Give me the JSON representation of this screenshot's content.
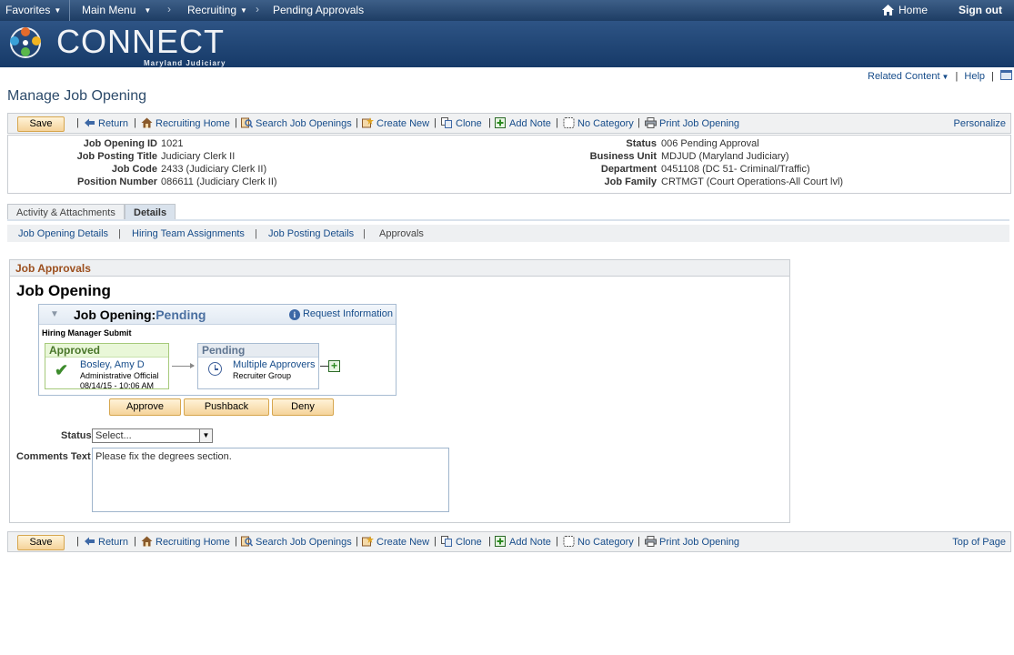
{
  "nav": {
    "favorites": "Favorites",
    "main_menu": "Main Menu",
    "recruiting": "Recruiting",
    "current": "Pending Approvals",
    "home": "Home",
    "sign_out": "Sign out"
  },
  "banner": {
    "logo": "CONNECT",
    "subtitle": "Maryland Judiciary"
  },
  "related": {
    "related_content": "Related Content",
    "help": "Help"
  },
  "page_title": "Manage Job Opening",
  "toolbar": {
    "save": "Save",
    "return": "Return",
    "recruiting_home": "Recruiting Home",
    "search": "Search Job Openings",
    "create_new": "Create New",
    "clone": "Clone",
    "add_note": "Add Note",
    "no_category": "No Category",
    "print": "Print Job Opening",
    "personalize": "Personalize",
    "top_of_page": "Top of Page"
  },
  "header": {
    "job_opening_id": {
      "label": "Job Opening ID",
      "value": "1021"
    },
    "job_posting_title": {
      "label": "Job Posting Title",
      "value": "Judiciary Clerk II"
    },
    "job_code": {
      "label": "Job Code",
      "value": "2433 (Judiciary Clerk II)"
    },
    "position_number": {
      "label": "Position Number",
      "value": "086611 (Judiciary Clerk II)"
    },
    "status": {
      "label": "Status",
      "value": "006 Pending Approval"
    },
    "business_unit": {
      "label": "Business Unit",
      "value": "MDJUD (Maryland Judiciary)"
    },
    "department": {
      "label": "Department",
      "value": "0451108 (DC 51- Criminal/Traffic)"
    },
    "job_family": {
      "label": "Job Family",
      "value": "CRTMGT (Court Operations-All Court lvl)"
    }
  },
  "tabs": {
    "activity": "Activity & Attachments",
    "details": "Details"
  },
  "subnav": {
    "job_opening_details": "Job Opening Details",
    "hiring_team": "Hiring Team Assignments",
    "job_posting": "Job Posting Details",
    "approvals": "Approvals"
  },
  "approvals": {
    "header": "Job Approvals",
    "title": "Job Opening",
    "flow_title": "Job Opening:",
    "flow_status": "Pending",
    "request_info": "Request Information",
    "stage": "Hiring Manager Submit",
    "approved": {
      "heading": "Approved",
      "name": "Bosley, Amy D",
      "role": "Administrative Official",
      "date": "08/14/15 - 10:06 AM"
    },
    "pending": {
      "heading": "Pending",
      "name": "Multiple Approvers",
      "group": "Recruiter Group"
    },
    "buttons": {
      "approve": "Approve",
      "pushback": "Pushback",
      "deny": "Deny"
    },
    "status_label": "Status",
    "status_value": "Select...",
    "comments_label": "Comments Text",
    "comments_value": "Please fix the degrees section."
  },
  "colors": {
    "nav_bg": "#1e3d64",
    "banner_bg": "#163a68",
    "button_bg": "#f5d39a",
    "section_header": "#9c4f1e",
    "link": "#164c8a",
    "approved_green": "#49762a"
  }
}
